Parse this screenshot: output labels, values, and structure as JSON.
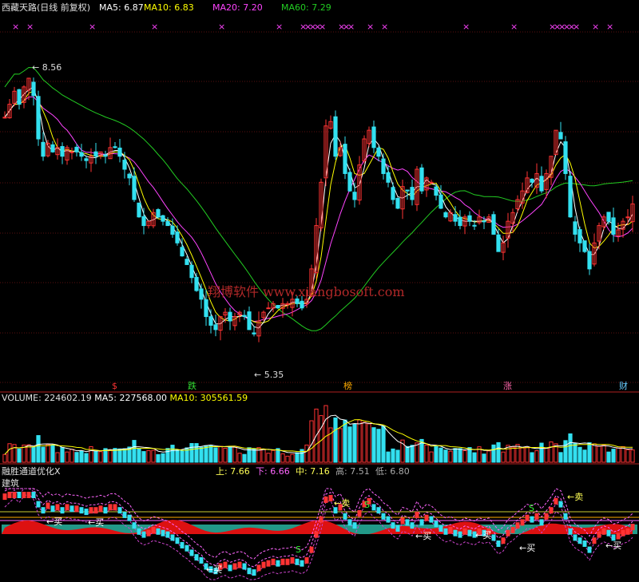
{
  "chart_data": [
    {
      "type": "candlestick",
      "title": "西藏天路(日线 前复权)",
      "indicators": [
        {
          "name": "MA5",
          "value": "6.87",
          "color": "#ffffff"
        },
        {
          "name": "MA10",
          "value": "6.83",
          "color": "#ffff00"
        },
        {
          "name": "MA20",
          "value": "7.20",
          "color": "#ff44ff"
        },
        {
          "name": "MA60",
          "value": "7.29",
          "color": "#22cc22"
        }
      ],
      "high_label": "8.56",
      "low_label": "5.35",
      "ylim": [
        5.0,
        9.2
      ],
      "up_color": "#ff3333",
      "down_color": "#33e0f0",
      "annotations": [
        {
          "text": "$",
          "color": "#ff3333"
        },
        {
          "text": "跌",
          "color": "#33dd33"
        },
        {
          "text": "榜",
          "color": "#ffaa00"
        },
        {
          "text": "涨",
          "color": "#ff66aa"
        },
        {
          "text": "财",
          "color": "#66ccff"
        }
      ],
      "closes": [
        8.05,
        8.2,
        8.35,
        8.2,
        8.4,
        8.5,
        8.3,
        7.8,
        7.6,
        7.75,
        7.65,
        7.7,
        7.6,
        7.7,
        7.65,
        7.65,
        7.6,
        7.55,
        7.6,
        7.6,
        7.65,
        7.6,
        7.7,
        7.7,
        7.6,
        7.45,
        7.35,
        7.1,
        6.9,
        6.8,
        6.85,
        6.95,
        6.9,
        6.85,
        6.8,
        6.7,
        6.6,
        6.45,
        6.35,
        6.2,
        6.05,
        5.95,
        5.75,
        5.65,
        5.6,
        5.75,
        5.8,
        5.7,
        5.75,
        5.8,
        5.75,
        5.6,
        5.55,
        5.7,
        5.8,
        5.85,
        5.9,
        5.85,
        5.9,
        5.9,
        5.95,
        5.9,
        5.85,
        5.95,
        6.3,
        6.8,
        7.3,
        7.95,
        8.0,
        7.6,
        7.7,
        7.4,
        7.2,
        7.1,
        7.5,
        7.8,
        7.9,
        7.7,
        7.6,
        7.4,
        7.3,
        7.1,
        7.0,
        7.25,
        7.2,
        7.1,
        7.45,
        7.2,
        7.35,
        7.3,
        7.15,
        7.0,
        6.9,
        6.95,
        6.85,
        6.8,
        6.9,
        6.85,
        6.8,
        6.9,
        6.85,
        6.9,
        6.7,
        6.5,
        6.6,
        6.85,
        6.95,
        7.1,
        7.2,
        7.35,
        7.3,
        7.4,
        7.2,
        7.4,
        7.6,
        7.9,
        7.8,
        7.4,
        6.9,
        6.7,
        6.6,
        6.5,
        6.3,
        6.6,
        6.8,
        6.9,
        6.85,
        6.7,
        6.75,
        6.85,
        6.9,
        7.05
      ],
      "volume": {
        "label": "VOLUME",
        "value": "224602.19",
        "ma5": "227568.00",
        "ma10": "305561.59"
      }
    },
    {
      "type": "indicator",
      "title": "融胜通道优化X",
      "subtitle": "建筑",
      "values": [
        {
          "name": "上",
          "value": "7.66",
          "color": "#ffff55"
        },
        {
          "name": "下",
          "value": "6.66",
          "color": "#ff66ff"
        },
        {
          "name": "中",
          "value": "7.16",
          "color": "#ffff55"
        },
        {
          "name": "高",
          "value": "7.51",
          "color": "#aaaaaa"
        },
        {
          "name": "低",
          "value": "6.80",
          "color": "#aaaaaa"
        }
      ],
      "signals": {
        "buy": "←买",
        "sell": "←卖",
        "s": "S"
      }
    }
  ],
  "watermark": "翔博软件 www.xiangbosoft.com"
}
